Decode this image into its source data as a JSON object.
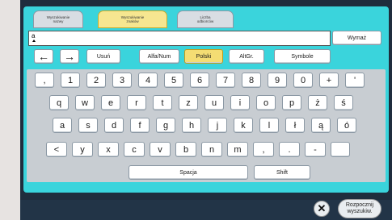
{
  "tabs": [
    {
      "line1": "Wyszukiwanie",
      "line2": "nazwy"
    },
    {
      "line1": "Wyszukiwanie",
      "line2": "znaków"
    },
    {
      "line1": "Liczba",
      "line2": "odbiorców"
    }
  ],
  "input": {
    "value": "a"
  },
  "buttons": {
    "clear": "Wymaż",
    "delete": "Usuń",
    "alfanum": "Alfa/Num",
    "polski": "Polski",
    "altgr": "AltGr.",
    "symbols": "Symbole",
    "space": "Spacja",
    "shift": "Shift",
    "start_line1": "Rozpocznij",
    "start_line2": "wyszukiw.",
    "close": "✕"
  },
  "arrows": {
    "left": "←",
    "right": "→"
  },
  "rows": [
    [
      ",",
      "1",
      "2",
      "3",
      "4",
      "5",
      "6",
      "7",
      "8",
      "9",
      "0",
      "+",
      "'"
    ],
    [
      "q",
      "w",
      "e",
      "r",
      "t",
      "z",
      "u",
      "i",
      "o",
      "p",
      "ż",
      "ś"
    ],
    [
      "a",
      "s",
      "d",
      "f",
      "g",
      "h",
      "j",
      "k",
      "l",
      "ł",
      "ą",
      "ó"
    ],
    [
      "<",
      "y",
      "x",
      "c",
      "v",
      "b",
      "n",
      "m",
      ",",
      ".",
      "-",
      ""
    ]
  ],
  "colors": {
    "panel": "#3ad4dc",
    "active_tab": "#f6e690",
    "active_key": "#f4dd73",
    "background": "#1f2d3d"
  }
}
